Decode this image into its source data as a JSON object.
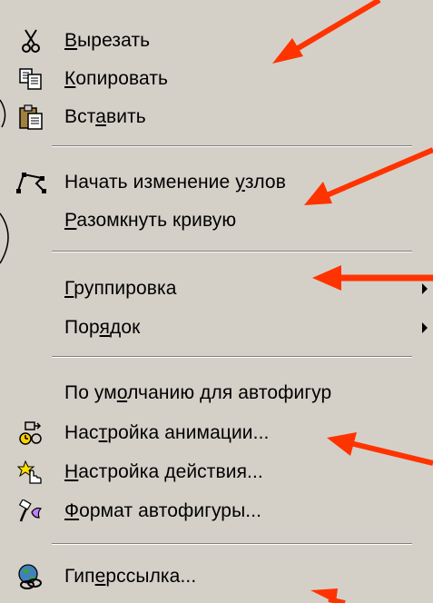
{
  "menu": {
    "items": [
      {
        "id": "cut",
        "label": "Вырезать",
        "underline_index": 0,
        "icon": "scissors-icon",
        "submenu": false
      },
      {
        "id": "copy",
        "label": "Копировать",
        "underline_index": 0,
        "icon": "copy-icon",
        "submenu": false
      },
      {
        "id": "paste",
        "label": "Вставить",
        "underline_index": 3,
        "icon": "paste-icon",
        "submenu": false
      },
      {
        "id": "edit-points",
        "label": "Начать изменение узлов",
        "underline_index": 17,
        "icon": "edit-points-icon",
        "submenu": false
      },
      {
        "id": "open-curve",
        "label": "Разомкнуть кривую",
        "underline_index": 0,
        "icon": "",
        "submenu": false
      },
      {
        "id": "grouping",
        "label": "Группировка",
        "underline_index": 0,
        "icon": "",
        "submenu": true
      },
      {
        "id": "order",
        "label": "Порядок",
        "underline_index": 3,
        "icon": "",
        "submenu": true
      },
      {
        "id": "defaults",
        "label": "По умолчанию для автофигур",
        "underline_index": 5,
        "icon": "",
        "submenu": false
      },
      {
        "id": "animation",
        "label": "Настройка анимации...",
        "underline_index": 3,
        "icon": "animation-icon",
        "submenu": false
      },
      {
        "id": "action",
        "label": "Настройка действия...",
        "underline_index": 0,
        "icon": "action-hand-icon",
        "submenu": false
      },
      {
        "id": "format",
        "label": "Формат автофигуры...",
        "underline_index": 0,
        "icon": "format-brush-icon",
        "submenu": false
      },
      {
        "id": "hyperlink",
        "label": "Гиперссылка...",
        "underline_index": 3,
        "icon": "hyperlink-globe-icon",
        "submenu": false
      }
    ]
  },
  "colors": {
    "menu_bg": "#d4d0c8",
    "annotation_arrow": "#ff3300"
  }
}
